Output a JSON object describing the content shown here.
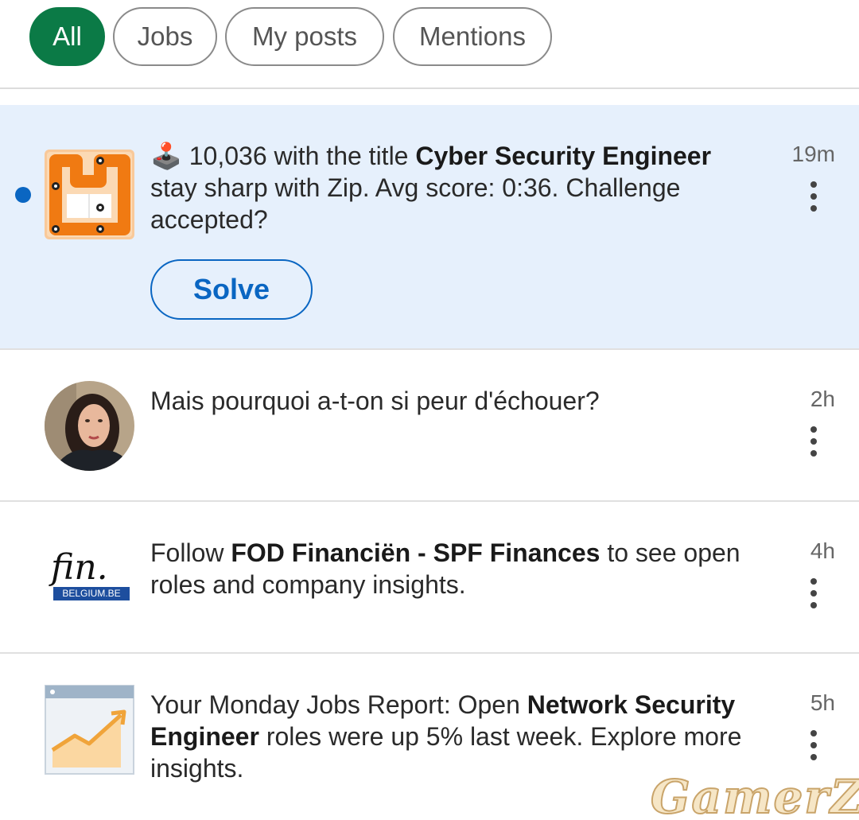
{
  "filters": [
    {
      "label": "All",
      "active": true
    },
    {
      "label": "Jobs",
      "active": false
    },
    {
      "label": "My posts",
      "active": false
    },
    {
      "label": "Mentions",
      "active": false
    }
  ],
  "notifications": [
    {
      "icon": "zip-game-icon",
      "emoji": "🕹️",
      "parts": [
        " 10,036 with the title ",
        "Cyber Security Engineer",
        " stay sharp with Zip. Avg score: 0:36. Challenge accepted?"
      ],
      "time": "19m",
      "unread": true,
      "action_label": "Solve"
    },
    {
      "icon": "profile-avatar",
      "text": "Mais pourquoi a-t-on si peur d'échouer?",
      "time": "2h"
    },
    {
      "icon": "fin-belgium-logo",
      "logo_text": "fin.",
      "logo_sub": "BELGIUM.BE",
      "parts": [
        "Follow ",
        "FOD Financiën - SPF Finances",
        " to see open roles and company insights."
      ],
      "time": "4h"
    },
    {
      "icon": "growth-chart-icon",
      "parts": [
        "Your Monday Jobs Report: Open ",
        "Network Security Engineer",
        " roles were up 5% last week. Explore more insights."
      ],
      "time": "5h"
    }
  ],
  "watermark": "GamerZ",
  "colors": {
    "accent_green": "#0b7a46",
    "link_blue": "#0a66c2",
    "unread_bg": "#e6f0fc"
  }
}
